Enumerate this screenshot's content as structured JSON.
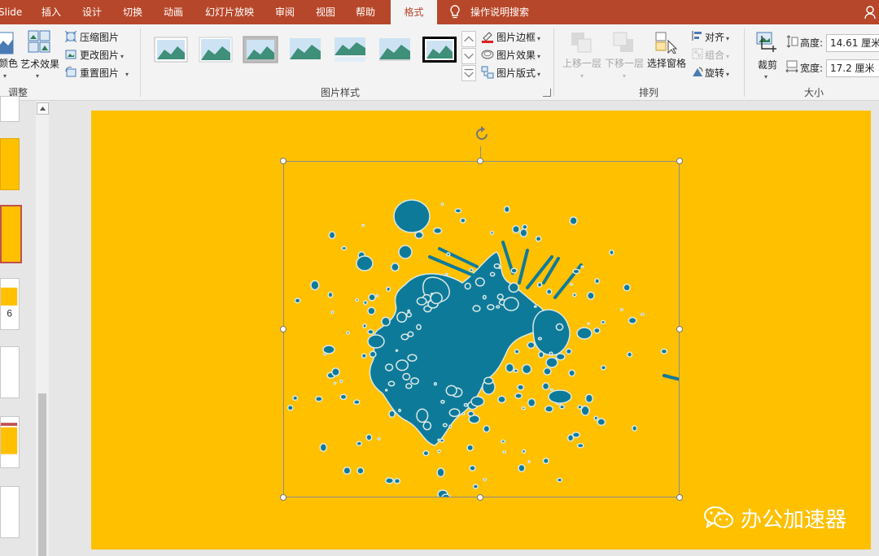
{
  "tabs": [
    "Slide",
    "插入",
    "设计",
    "切换",
    "动画",
    "幻灯片放映",
    "审阅",
    "视图",
    "帮助",
    "格式"
  ],
  "active_tab": "格式",
  "tell_me": "操作说明搜索",
  "ribbon": {
    "adjust": {
      "color_label": "颜色",
      "art_effects_label": "艺术效果",
      "compress": "压缩图片",
      "change": "更改图片",
      "reset": "重置图片",
      "group_label": "调整"
    },
    "styles": {
      "border": "图片边框",
      "effects": "图片效果",
      "layout": "图片版式",
      "group_label": "图片样式"
    },
    "arrange": {
      "bring_forward": "上移一层",
      "send_backward": "下移一层",
      "selection_pane": "选择窗格",
      "align": "对齐",
      "group": "组合",
      "rotate": "旋转",
      "group_label": "排列"
    },
    "size": {
      "crop": "裁剪",
      "height_label": "高度:",
      "height_value": "14.61 厘米",
      "width_label": "宽度:",
      "width_value": "17.2 厘米",
      "group_label": "大小"
    }
  },
  "watermark": "办公加速器",
  "colors": {
    "ribbon_red": "#b7472a",
    "slide_yellow": "#ffc000",
    "splash_teal": "#0e7a9a"
  }
}
